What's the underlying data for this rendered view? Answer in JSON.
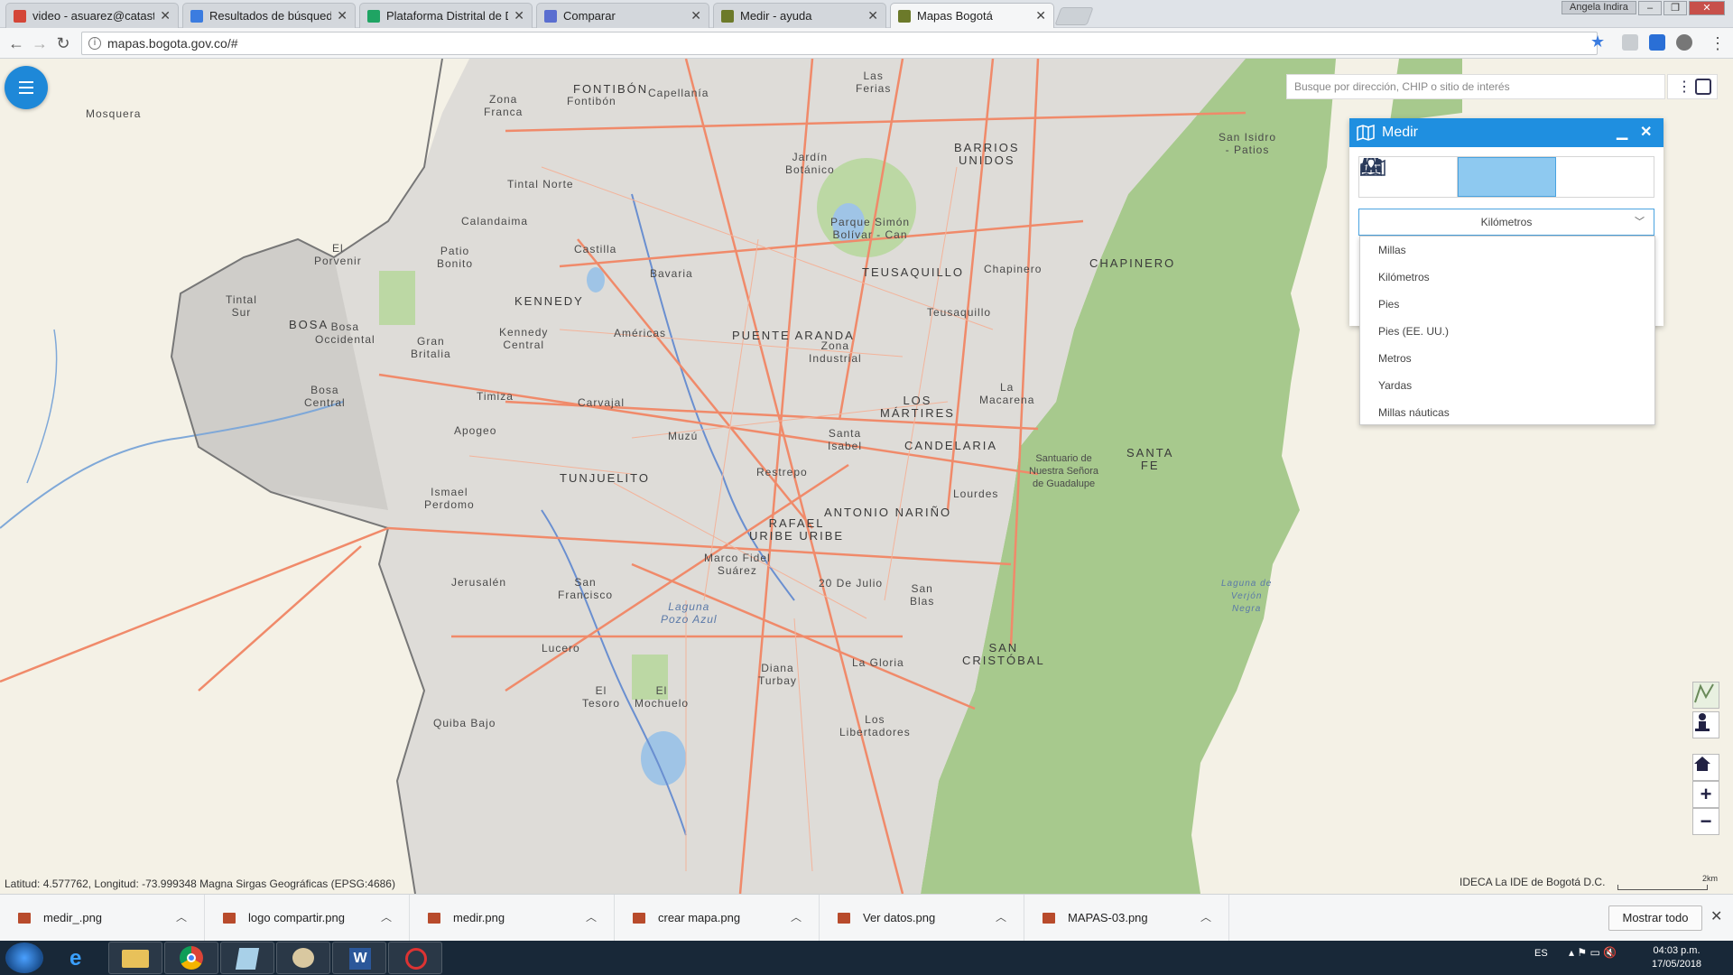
{
  "browser": {
    "tabs": [
      {
        "label": "video - asuarez@catastro",
        "icon": "gmail-icon",
        "color": "#d44638"
      },
      {
        "label": "Resultados de búsqueda",
        "icon": "drive-icon",
        "color": "#3b7ce0"
      },
      {
        "label": "Plataforma Distrital de D",
        "icon": "sheets-icon",
        "color": "#1fa463"
      },
      {
        "label": "Comparar",
        "icon": "forms-icon",
        "color": "#5a6ed0"
      },
      {
        "label": "Medir - ayuda",
        "icon": "map-site-icon",
        "color": "#6c7a2a"
      },
      {
        "label": "Mapas Bogotá",
        "icon": "map-site-icon",
        "color": "#6c7a2a"
      }
    ],
    "user": "Angela Indira",
    "url": "mapas.bogota.gov.co/#"
  },
  "map": {
    "search_placeholder": "Busque por dirección, CHIP o sitio de interés",
    "places": [
      {
        "name": "Mosquera",
        "big": false
      },
      {
        "name": "FONTIBÓN",
        "big": true
      },
      {
        "name": "Fontibón",
        "big": false
      },
      {
        "name": "Capellanía",
        "big": false
      },
      {
        "name": "Zona\nFranca",
        "big": false
      },
      {
        "name": "Las\nFerias",
        "big": false
      },
      {
        "name": "BARRIOS\nUNIDOS",
        "big": true
      },
      {
        "name": "San Isidro\n- Patios",
        "big": false
      },
      {
        "name": "Jardín\nBotánico",
        "big": false
      },
      {
        "name": "Tintal Norte",
        "big": false
      },
      {
        "name": "Calandaima",
        "big": false
      },
      {
        "name": "Parque Simón\nBolívar - Can",
        "big": false
      },
      {
        "name": "El\nPorvenir",
        "big": false
      },
      {
        "name": "Patio\nBonito",
        "big": false
      },
      {
        "name": "Castilla",
        "big": false
      },
      {
        "name": "Bavaria",
        "big": false
      },
      {
        "name": "TEUSAQUILLO",
        "big": true
      },
      {
        "name": "Chapinero",
        "big": false
      },
      {
        "name": "CHAPINERO",
        "big": true
      },
      {
        "name": "Tintal\nSur",
        "big": false
      },
      {
        "name": "KENNEDY",
        "big": true
      },
      {
        "name": "Teusaquillo",
        "big": false
      },
      {
        "name": "BOSA",
        "big": true
      },
      {
        "name": "Bosa\nOccidental",
        "big": false
      },
      {
        "name": "Kennedy\nCentral",
        "big": false
      },
      {
        "name": "Américas",
        "big": false
      },
      {
        "name": "PUENTE ARANDA",
        "big": true
      },
      {
        "name": "Gran\nBritalia",
        "big": false
      },
      {
        "name": "Zona\nIndustrial",
        "big": false
      },
      {
        "name": "Bosa\nCentral",
        "big": false
      },
      {
        "name": "Timiza",
        "big": false
      },
      {
        "name": "Carvajal",
        "big": false
      },
      {
        "name": "LOS\nMÁRTIRES",
        "big": true
      },
      {
        "name": "La\nMacarena",
        "big": false
      },
      {
        "name": "Apogeo",
        "big": false
      },
      {
        "name": "Muzú",
        "big": false
      },
      {
        "name": "Santa\nIsabel",
        "big": false
      },
      {
        "name": "CANDELARIA",
        "big": true
      },
      {
        "name": "SANTA\nFE",
        "big": true
      },
      {
        "name": "Santuario de\nNuestra Señora\nde Guadalupe",
        "big": false
      },
      {
        "name": "TUNJUELITO",
        "big": true
      },
      {
        "name": "Restrepo",
        "big": false
      },
      {
        "name": "Ismael\nPerdomo",
        "big": false
      },
      {
        "name": "Lourdes",
        "big": false
      },
      {
        "name": "ANTONIO NARIÑO",
        "big": true
      },
      {
        "name": "RAFAEL\nURIBE URIBE",
        "big": true
      },
      {
        "name": "Marco Fidel\nSuárez",
        "big": false
      },
      {
        "name": "Jerusalén",
        "big": false
      },
      {
        "name": "San\nFrancisco",
        "big": false
      },
      {
        "name": "20 De Julio",
        "big": false
      },
      {
        "name": "San\nBlas",
        "big": false
      },
      {
        "name": "Laguna\nPozo Azul",
        "big": false
      },
      {
        "name": "Lucero",
        "big": false
      },
      {
        "name": "Diana\nTurbay",
        "big": false
      },
      {
        "name": "La Gloria",
        "big": false
      },
      {
        "name": "SAN\nCRISTÓBAL",
        "big": true
      },
      {
        "name": "El\nTesoro",
        "big": false
      },
      {
        "name": "El\nMochuelo",
        "big": false
      },
      {
        "name": "Quiba Bajo",
        "big": false
      },
      {
        "name": "Los\nLibertadores",
        "big": false
      },
      {
        "name": "Laguna de\nVerjón\nNegra",
        "big": false
      }
    ],
    "coordinates": "Latitud: 4.577762, Longitud: -73.999348 Magna Sirgas Geográficas (EPSG:4686)",
    "attribution": "IDECA La IDE de Bogotá D.C.",
    "scale_label": "2km"
  },
  "panel": {
    "title": "Medir",
    "tools": [
      "area-measure-icon",
      "distance-measure-icon",
      "location-measure-icon"
    ],
    "selected_unit": "Kilómetros",
    "unit_options": [
      "Millas",
      "Kilómetros",
      "Pies",
      "Pies (EE. UU.)",
      "Metros",
      "Yardas",
      "Millas náuticas"
    ]
  },
  "downloads": {
    "files": [
      "medir_.png",
      "logo compartir.png",
      "medir.png",
      "crear mapa.png",
      "Ver datos.png",
      "MAPAS-03.png"
    ],
    "show_all": "Mostrar todo"
  },
  "taskbar": {
    "language": "ES",
    "time": "04:03 p.m.",
    "date": "17/05/2018"
  }
}
